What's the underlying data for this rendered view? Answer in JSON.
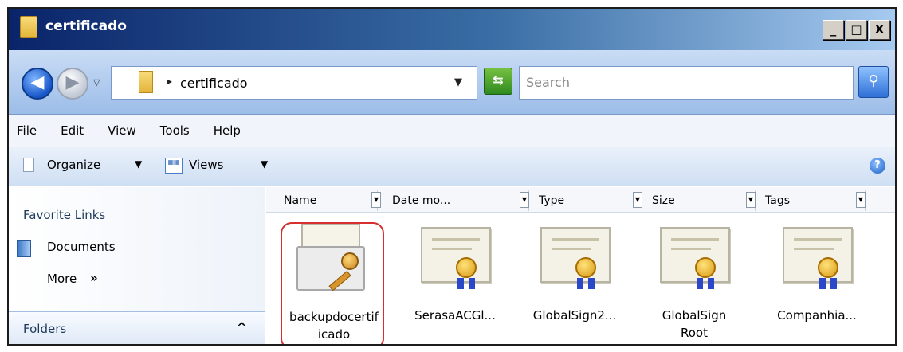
{
  "window": {
    "title": "certificado",
    "controls": {
      "minimize": "_",
      "maximize": "□",
      "close": "X"
    }
  },
  "address": {
    "path": "certificado",
    "search_placeholder": "Search"
  },
  "menu": [
    "File",
    "Edit",
    "View",
    "Tools",
    "Help"
  ],
  "command_bar": {
    "organize": "Organize",
    "views": "Views"
  },
  "nav_pane": {
    "favorite_links": "Favorite Links",
    "items": [
      "Documents"
    ],
    "more": "More",
    "more_glyph": "»",
    "folders": "Folders"
  },
  "columns": [
    "Name",
    "Date mo...",
    "Type",
    "Size",
    "Tags"
  ],
  "files": [
    {
      "line1": "backupdocertif",
      "line2": "icado",
      "icon": "certificate-key-envelope-icon",
      "selected": true
    },
    {
      "line1": "SerasaACGl...",
      "line2": "",
      "icon": "certificate-icon",
      "selected": false
    },
    {
      "line1": "GlobalSign2...",
      "line2": "",
      "icon": "certificate-icon",
      "selected": false
    },
    {
      "line1": "GlobalSign",
      "line2": "Root",
      "icon": "certificate-icon",
      "selected": false
    },
    {
      "line1": "Companhia...",
      "line2": "",
      "icon": "certificate-icon",
      "selected": false
    }
  ],
  "colors": {
    "selection_outline": "#d82e2e",
    "titlebar": "#0a246a"
  }
}
